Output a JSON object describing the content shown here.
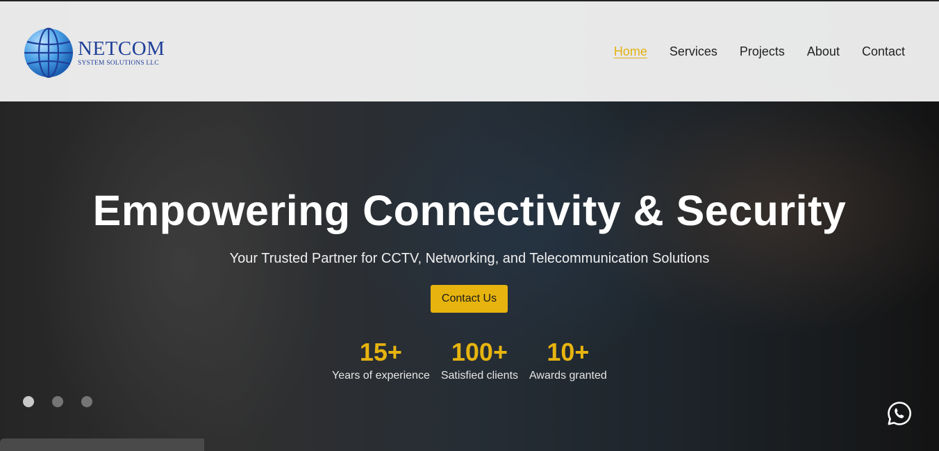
{
  "brand": {
    "name": "NETCOM",
    "tagline": "SYSTEM SOLUTIONS LLC",
    "color": "#1f3f99"
  },
  "nav": {
    "items": [
      {
        "label": "Home",
        "active": true
      },
      {
        "label": "Services",
        "active": false
      },
      {
        "label": "Projects",
        "active": false
      },
      {
        "label": "About",
        "active": false
      },
      {
        "label": "Contact",
        "active": false
      }
    ],
    "active_color": "#e2b20f"
  },
  "hero": {
    "title": "Empowering Connectivity & Security",
    "subtitle": "Your Trusted Partner for CCTV, Networking, and Telecommunication Solutions",
    "cta_label": "Contact Us",
    "accent": "#e7b40f"
  },
  "stats": [
    {
      "value": "15+",
      "label": "Years of experience"
    },
    {
      "value": "100+",
      "label": "Satisfied clients"
    },
    {
      "value": "10+",
      "label": "Awards granted"
    }
  ],
  "slider": {
    "count": 3,
    "active_index": 0
  },
  "icons": {
    "logo": "globe-icon",
    "chat": "whatsapp-icon"
  }
}
